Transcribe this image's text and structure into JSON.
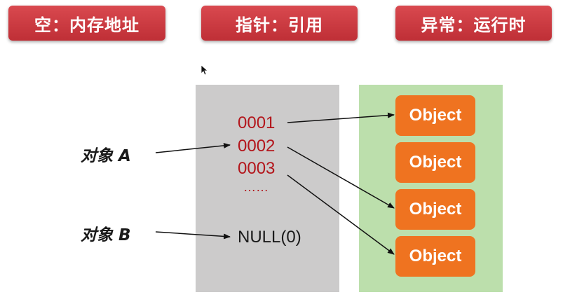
{
  "banners": [
    "空：内存地址",
    "指针：引用",
    "异常：运行时"
  ],
  "memory": {
    "addresses": [
      "0001",
      "0002",
      "0003",
      "……"
    ],
    "null_value": "NULL(0)"
  },
  "labels": {
    "object_a": "对象 A",
    "object_b": "对象 B"
  },
  "heap": {
    "objects": [
      "Object",
      "Object",
      "Object",
      "Object"
    ]
  },
  "colors": {
    "banner": "#c8383e",
    "memory_bg": "#cccbcb",
    "heap_bg": "#bcdfac",
    "address_text": "#b3151b",
    "object_box": "#ef7320"
  }
}
